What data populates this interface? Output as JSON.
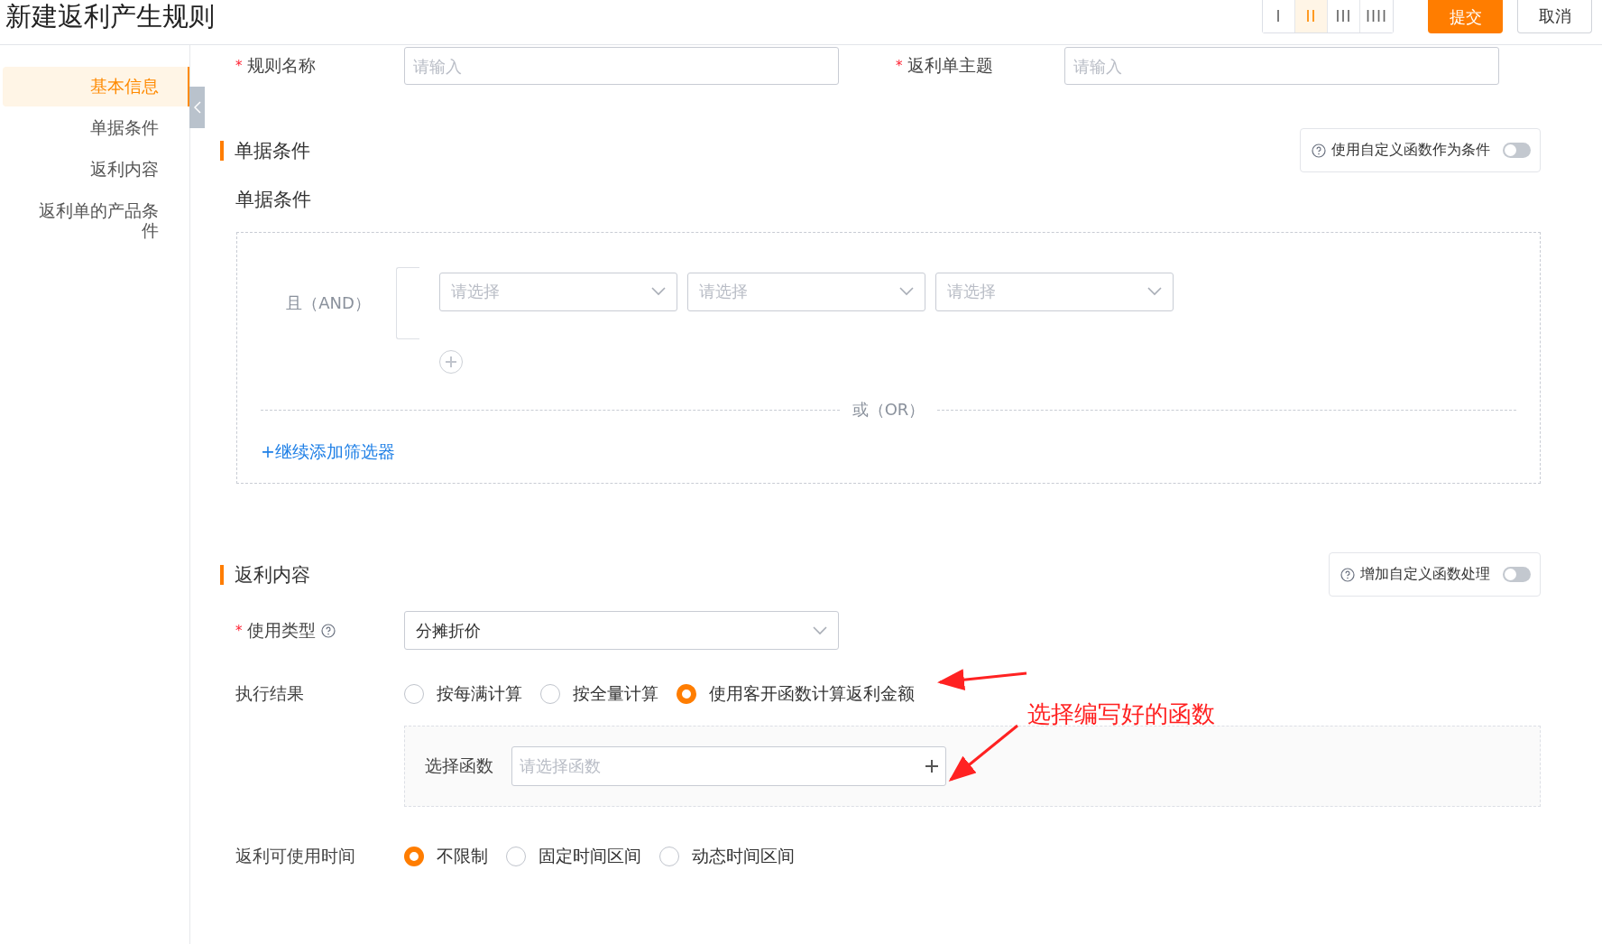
{
  "page_title": "新建返利产生规则",
  "view_toggle": [
    {
      "label": "I",
      "selected": false
    },
    {
      "label": "II",
      "selected": true
    },
    {
      "label": "III",
      "selected": false
    },
    {
      "label": "IIII",
      "selected": false
    }
  ],
  "actions": [
    {
      "label": "提交",
      "kind": "primary"
    },
    {
      "label": "取消",
      "kind": "default"
    }
  ],
  "sidebar": {
    "items": [
      {
        "label": "基本信息",
        "selected": true
      },
      {
        "label": "单据条件",
        "selected": false
      },
      {
        "label": "返利内容",
        "selected": false
      },
      {
        "label": "返利单的产品条件",
        "selected": false
      }
    ]
  },
  "top_fields": [
    {
      "label": "规则名称",
      "required_mark": "*",
      "placeholder": "请输入"
    },
    {
      "label": "返利单主题",
      "required_mark": "*",
      "placeholder": "请输入"
    }
  ],
  "conditions_section": {
    "title": "单据条件",
    "toggle": {
      "label": "使用自定义函数作为条件",
      "on": false
    },
    "subtitle": "单据条件",
    "group": {
      "operator": "且（AND）",
      "selects": [
        {
          "placeholder": "请选择"
        },
        {
          "placeholder": "请选择"
        },
        {
          "placeholder": "请选择"
        }
      ],
      "or_label": "或（OR）",
      "add_link": "+继续添加筛选器"
    }
  },
  "rebate_section": {
    "title": "返利内容",
    "toggle": {
      "label": "增加自定义函数处理",
      "on": false
    },
    "usage_type": {
      "label": "使用类型",
      "required_mark": "*",
      "value": "分摊折价"
    },
    "result": {
      "label": "执行结果",
      "options": [
        {
          "label": "按每满计算",
          "selected": false
        },
        {
          "label": "按全量计算",
          "selected": false
        },
        {
          "label": "使用客开函数计算返利金额",
          "selected": true
        }
      ]
    },
    "function_field": {
      "label": "选择函数",
      "placeholder": "请选择函数"
    },
    "usable_time": {
      "label": "返利可使用时间",
      "options": [
        {
          "label": "不限制",
          "selected": true
        },
        {
          "label": "固定时间区间",
          "selected": false
        },
        {
          "label": "动态时间区间",
          "selected": false
        }
      ]
    }
  },
  "annotation": {
    "text": "选择编写好的函数"
  }
}
